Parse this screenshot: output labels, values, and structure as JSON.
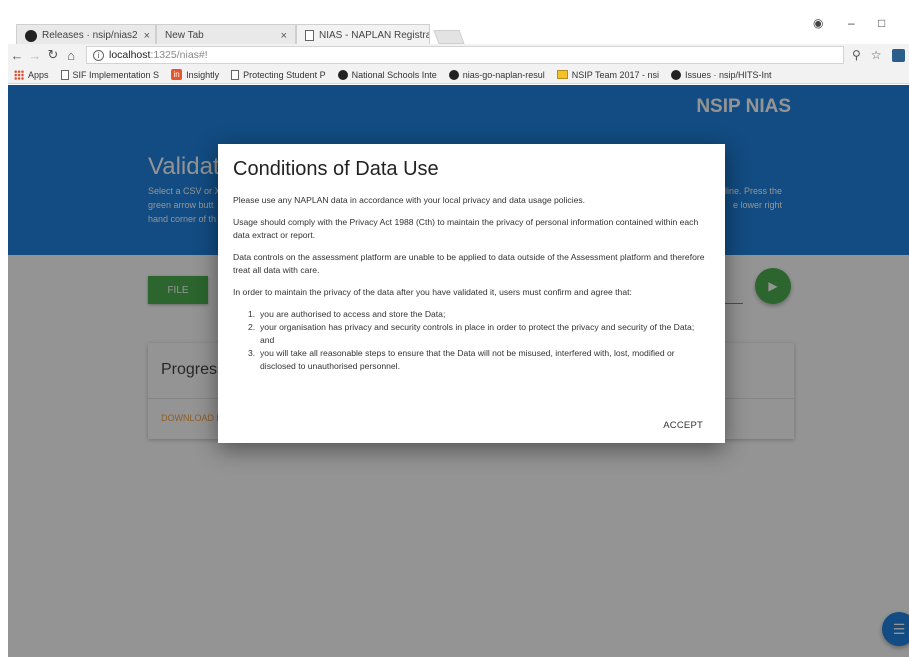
{
  "browser": {
    "tabs": [
      {
        "label": "Releases · nsip/nias2",
        "icon": "github-icon"
      },
      {
        "label": "New Tab",
        "icon": ""
      },
      {
        "label": "NIAS - NAPLAN Registra",
        "icon": "document-icon"
      }
    ],
    "address": {
      "host": "localhost",
      "path": ":1325/nias#!"
    },
    "bookmarks": [
      {
        "label": "Apps",
        "icon": "apps-icon"
      },
      {
        "label": "SIF Implementation S",
        "icon": "document-icon"
      },
      {
        "label": "Insightly",
        "icon": "insightly-icon"
      },
      {
        "label": "Protecting Student P",
        "icon": "document-icon"
      },
      {
        "label": "National Schools Inte",
        "icon": "github-icon"
      },
      {
        "label": "nias-go-naplan-resul",
        "icon": "github-icon"
      },
      {
        "label": "NSIP Team 2017 - nsi",
        "icon": "nsip-icon"
      },
      {
        "label": "Issues · nsip/HITS-Int",
        "icon": "github-icon"
      }
    ]
  },
  "app": {
    "brand": "NSIP NIAS",
    "hero_title": "Validate",
    "hero_text_left": [
      "Select a CSV or X",
      "green arrow butt",
      "hand corner of th"
    ],
    "hero_text_right": [
      "y line. Press the",
      "e lower right"
    ],
    "file_button": "FILE",
    "progress_title": "Progress",
    "download_link": "DOWNLOAD F"
  },
  "modal": {
    "title": "Conditions of Data Use",
    "paragraphs": [
      "Please use any NAPLAN data in accordance with your local privacy and data usage policies.",
      "Usage should comply with the Privacy Act 1988 (Cth) to maintain the privacy of personal information contained within each data extract or report.",
      "Data controls on the assessment platform are unable to be applied to data outside of the Assessment platform and therefore treat all data with care.",
      "In order to maintain the privacy of the data after you have validated it, users must confirm and agree that:"
    ],
    "list": [
      {
        "num": "1.",
        "text": "you are authorised to access and store the Data;"
      },
      {
        "num": "2.",
        "text": "your organisation has privacy and security controls in place in order to protect the privacy and security of the Data; and"
      },
      {
        "num": "3.",
        "text": "you will take all reasonable steps to ensure that the Data will not be misused, interfered with, lost, modified or disclosed to unauthorised personnel."
      }
    ],
    "accept_label": "ACCEPT"
  },
  "colors": {
    "primary": "#1f83e0",
    "success": "#4cae4f",
    "link": "#f0a44b"
  }
}
